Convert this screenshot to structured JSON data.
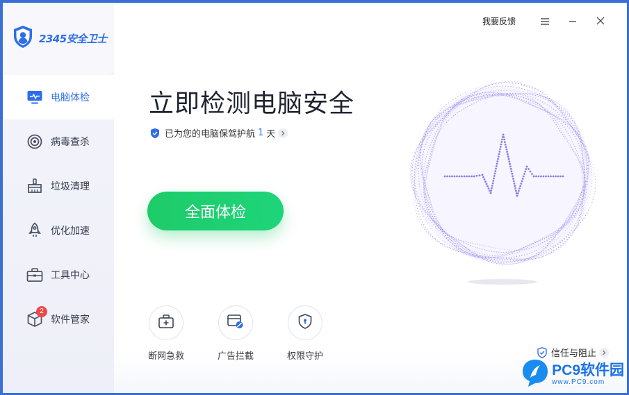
{
  "app": {
    "brand_icon": "shield-user-icon",
    "brand_name": "2345安全卫士"
  },
  "titlebar": {
    "feedback_label": "我要反馈",
    "menu_icon": "menu-icon",
    "minimize_icon": "minimize-icon",
    "close_icon": "close-icon"
  },
  "sidebar": {
    "items": [
      {
        "label": "电脑体检",
        "icon": "monitor-pulse-icon",
        "active": true
      },
      {
        "label": "病毒查杀",
        "icon": "target-icon",
        "active": false
      },
      {
        "label": "垃圾清理",
        "icon": "broom-icon",
        "active": false
      },
      {
        "label": "优化加速",
        "icon": "rocket-icon",
        "active": false
      },
      {
        "label": "工具中心",
        "icon": "toolbox-icon",
        "active": false
      },
      {
        "label": "软件管家",
        "icon": "package-icon",
        "active": false,
        "badge": "2"
      }
    ]
  },
  "main": {
    "headline": "立即检测电脑安全",
    "guard_prefix": "已为您的电脑保驾护航",
    "guard_days": "1",
    "guard_suffix": "天",
    "scan_button": "全面体检",
    "tools": [
      {
        "label": "断网急救",
        "icon": "first-aid-kit-icon"
      },
      {
        "label": "广告拦截",
        "icon": "ad-block-icon"
      },
      {
        "label": "权限守护",
        "icon": "shield-lock-icon"
      }
    ],
    "trust_label": "信任与阻止"
  },
  "watermark": {
    "title": "PC9软件园",
    "url": "www.PC9.com"
  },
  "colors": {
    "accent": "#2e6fe8",
    "scan_green": "#1ecb69",
    "orb_purple": "#8a7de8",
    "badge_red": "#f0484a"
  }
}
